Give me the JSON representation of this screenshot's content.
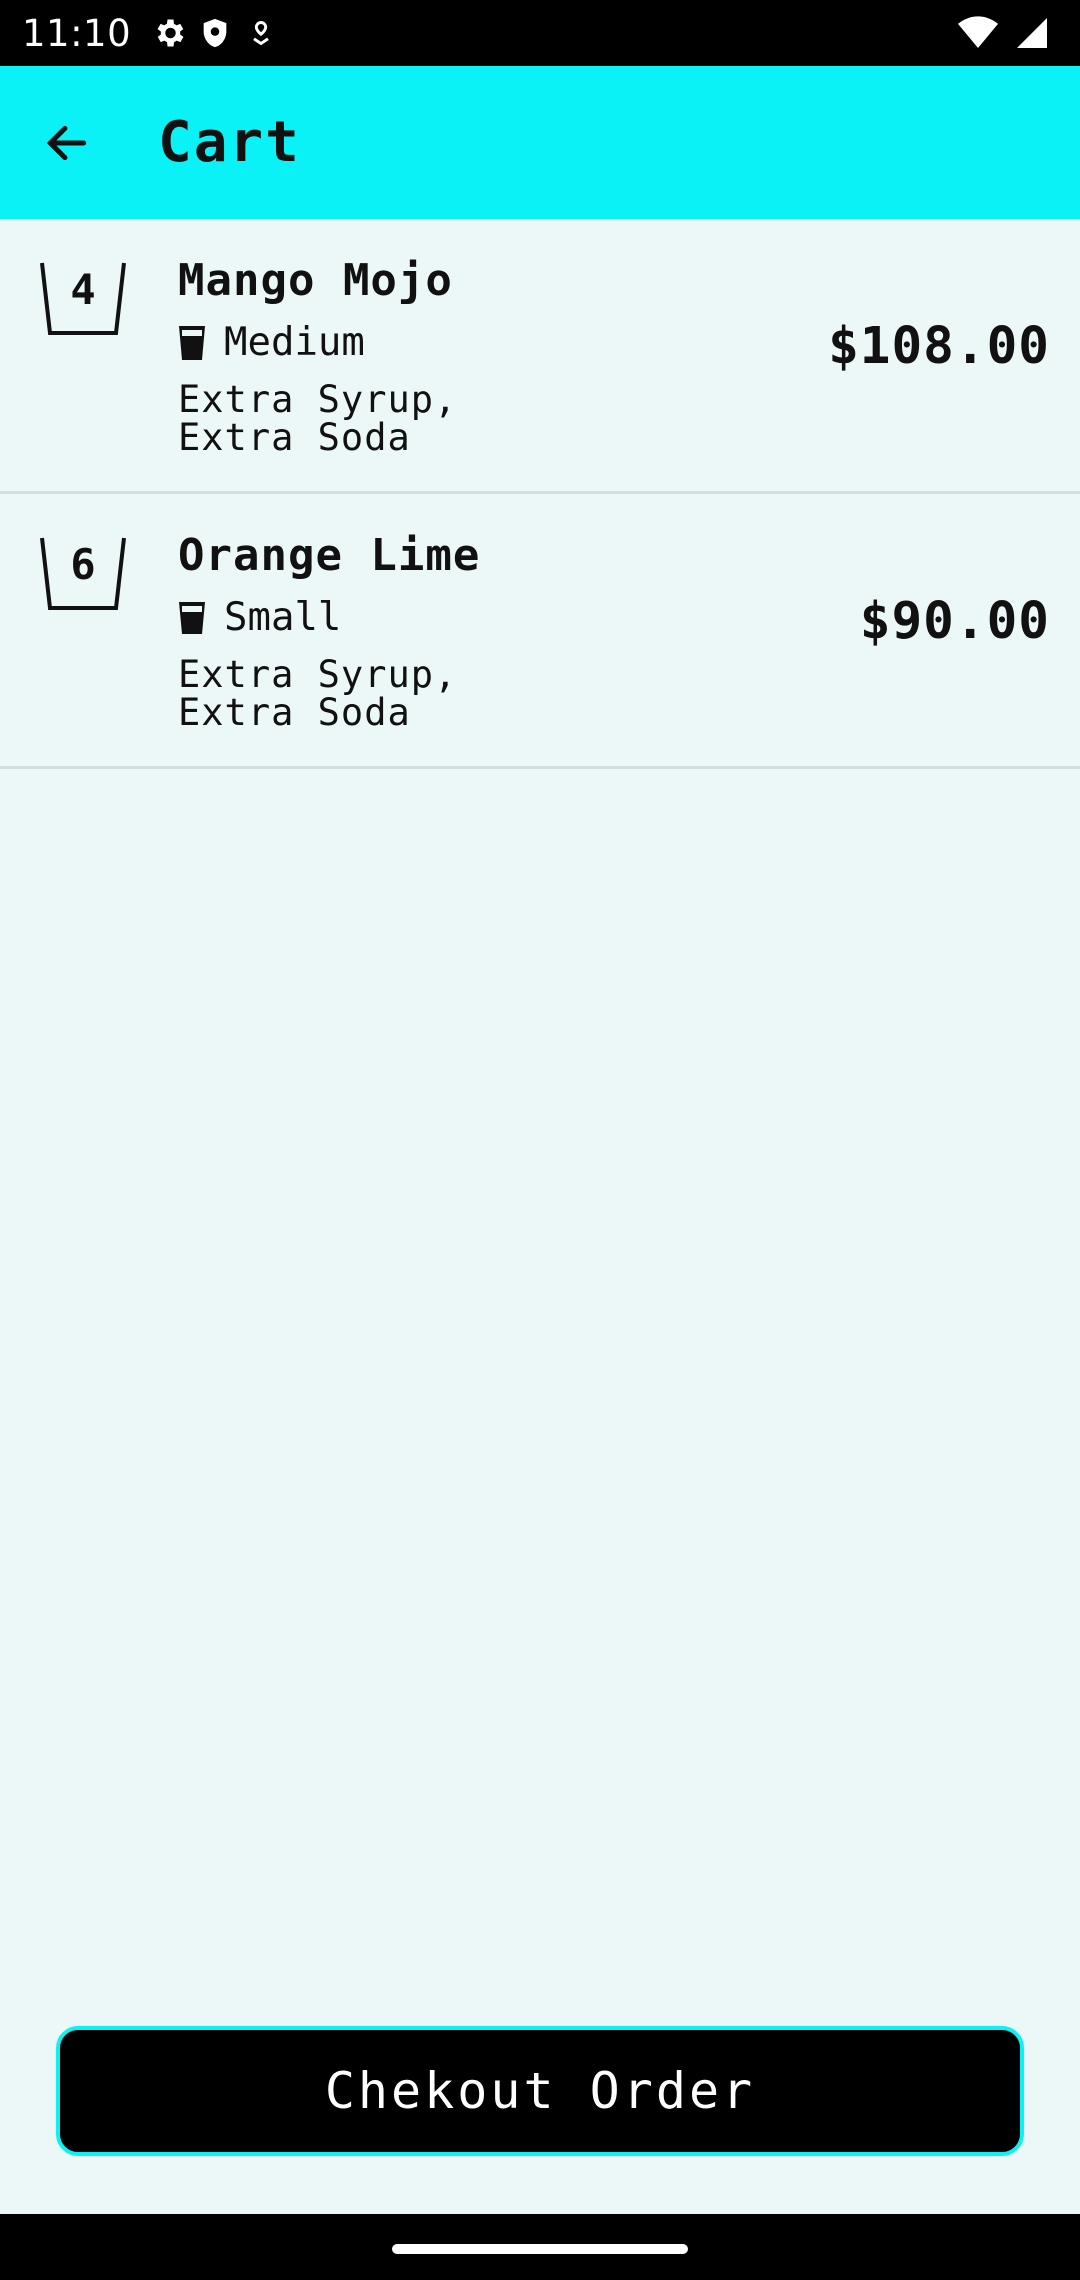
{
  "status_bar": {
    "time": "11:10",
    "icons_left": [
      "settings-gear-icon",
      "shield-icon",
      "location-pin-icon"
    ],
    "icons_right": [
      "wifi-icon",
      "signal-icon"
    ]
  },
  "app_bar": {
    "title": "Cart",
    "back_icon": "arrow-left-icon",
    "background": "#0AF2F5"
  },
  "cart": {
    "items": [
      {
        "quantity": "4",
        "name": "Mango Mojo",
        "size": "Medium",
        "size_icon": "cup-medium-icon",
        "extras": "Extra Syrup,\nExtra Soda",
        "price": "$108.00"
      },
      {
        "quantity": "6",
        "name": "Orange Lime",
        "size": "Small",
        "size_icon": "cup-small-icon",
        "extras": "Extra Syrup,\nExtra Soda",
        "price": "$90.00"
      }
    ]
  },
  "checkout": {
    "label": "Chekout Order",
    "border_color": "#0AF2F5"
  }
}
